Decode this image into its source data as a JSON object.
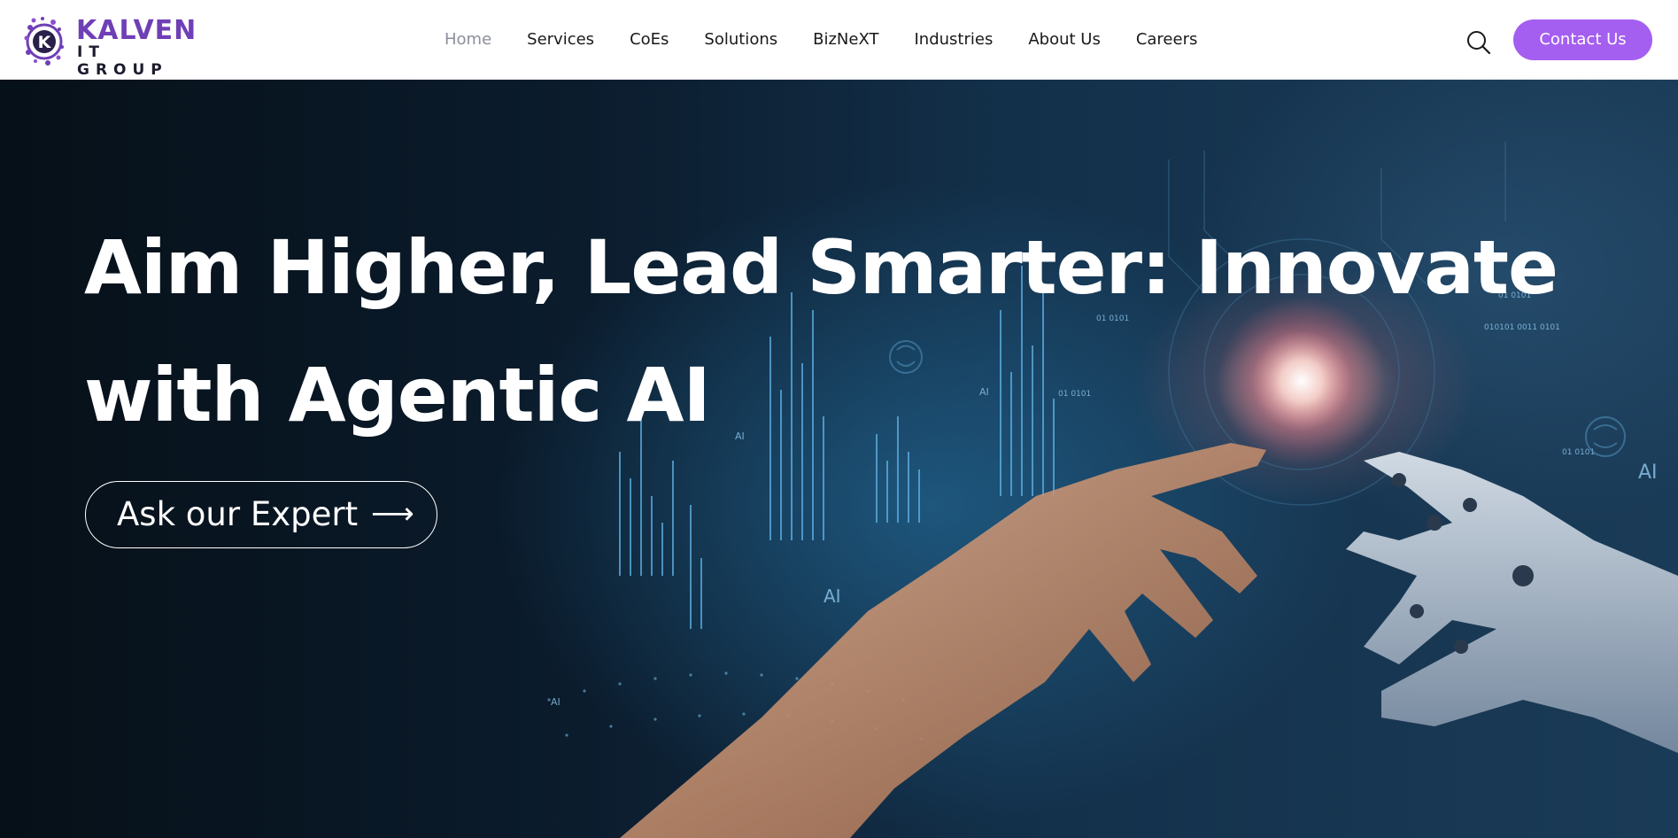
{
  "brand": {
    "name_line1": "KALVEN",
    "name_line2": "IT GROUP",
    "mark_letter": "K",
    "primary_color": "#6f3fb6",
    "accent_color": "#a45ef0"
  },
  "nav": {
    "items": [
      {
        "label": "Home",
        "active": true
      },
      {
        "label": "Services",
        "active": false
      },
      {
        "label": "CoEs",
        "active": false
      },
      {
        "label": "Solutions",
        "active": false
      },
      {
        "label": "BizNeXT",
        "active": false
      },
      {
        "label": "Industries",
        "active": false
      },
      {
        "label": "About Us",
        "active": false
      },
      {
        "label": "Careers",
        "active": false
      }
    ]
  },
  "header": {
    "search_icon": "search-icon",
    "contact_label": "Contact Us"
  },
  "hero": {
    "title_line1": "Aim Higher, Lead Smarter: Innovate",
    "title_line2": "with Agentic AI",
    "cta_label": "Ask our Expert",
    "cta_icon": "arrow-right-icon",
    "cta_arrow": "⟶",
    "image_labels": [
      "AI",
      "AI",
      "AI",
      "AI",
      "AI",
      "01 0101",
      "01 0101",
      "010101 0011 0101",
      "01 0101",
      "01 0101"
    ]
  }
}
